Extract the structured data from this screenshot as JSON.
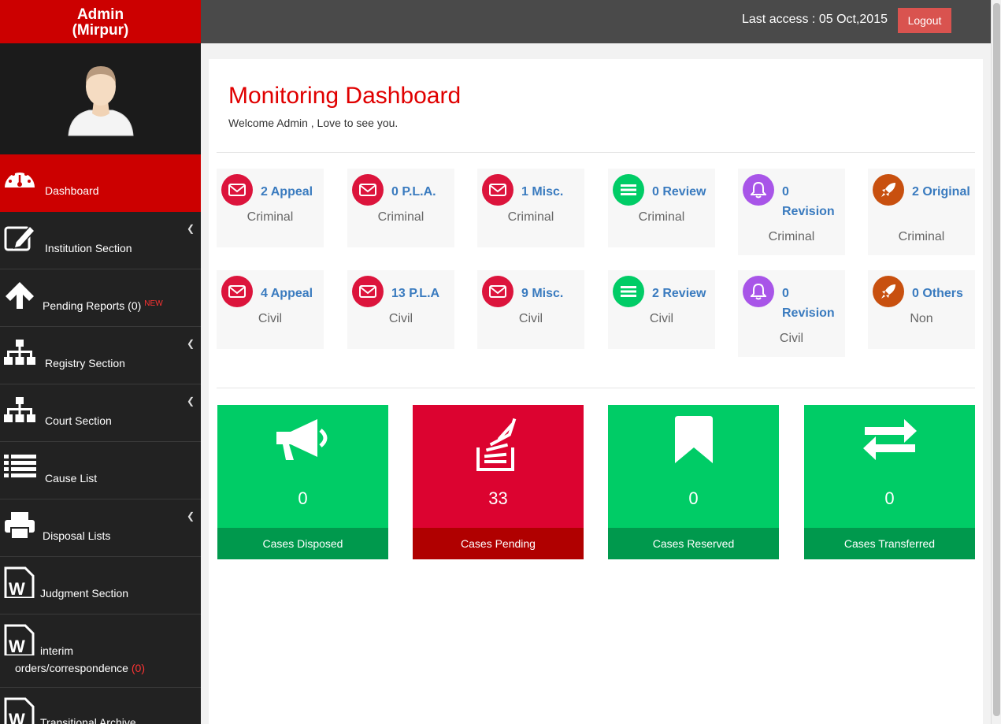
{
  "brand": {
    "line1": "Admin",
    "line2": "(Mirpur)"
  },
  "topbar": {
    "last_access": "Last access : 05 Oct,2015",
    "logout_label": "Logout"
  },
  "sidebar": {
    "items": [
      {
        "label": "Dashboard",
        "icon": "dashboard-icon"
      },
      {
        "label": "Institution Section",
        "icon": "edit-icon"
      },
      {
        "label": "Pending Reports (0)",
        "badge": "NEW",
        "icon": "arrow-up-icon"
      },
      {
        "label": "Registry Section",
        "icon": "sitemap-icon"
      },
      {
        "label": "Court Section",
        "icon": "sitemap-icon"
      },
      {
        "label": "Cause List",
        "icon": "list-icon"
      },
      {
        "label": "Disposal Lists",
        "icon": "print-icon"
      },
      {
        "label": "Judgment Section",
        "icon": "word-file-icon"
      },
      {
        "label_line1": "interim",
        "label_line2": "orders/correspondence",
        "count": "(0)",
        "icon": "word-file-icon"
      },
      {
        "label": "Transitional Archive",
        "icon": "word-file-icon"
      }
    ]
  },
  "main": {
    "title": "Monitoring Dashboard",
    "welcome": "Welcome Admin , Love to see you."
  },
  "stats": [
    {
      "value": "2 Appeal",
      "sub": "Criminal",
      "icon": "envelope-icon"
    },
    {
      "value": "0 P.L.A.",
      "sub": "Criminal",
      "icon": "envelope-icon"
    },
    {
      "value": "1 Misc.",
      "sub": "Criminal",
      "icon": "envelope-icon"
    },
    {
      "value": "0 Review",
      "sub": "Criminal",
      "icon": "bars-icon"
    },
    {
      "value": "0 Revision",
      "sub": "Criminal",
      "icon": "bell-icon"
    },
    {
      "value": "2 Original",
      "sub": "Criminal",
      "icon": "rocket-icon"
    },
    {
      "value": "4 Appeal",
      "sub": "Civil",
      "icon": "envelope-icon"
    },
    {
      "value": "13 P.L.A",
      "sub": "Civil",
      "icon": "envelope-icon"
    },
    {
      "value": "9 Misc.",
      "sub": "Civil",
      "icon": "envelope-icon"
    },
    {
      "value": "2 Review",
      "sub": "Civil",
      "icon": "bars-icon"
    },
    {
      "value": "0 Revision",
      "sub": "Civil",
      "icon": "bell-icon"
    },
    {
      "value": "0 Others",
      "sub": "Non",
      "icon": "rocket-icon"
    }
  ],
  "summary": [
    {
      "count": "0",
      "label": "Cases Disposed",
      "icon": "bullhorn-icon"
    },
    {
      "count": "33",
      "label": "Cases Pending",
      "icon": "stack-icon"
    },
    {
      "count": "0",
      "label": "Cases Reserved",
      "icon": "bookmark-icon"
    },
    {
      "count": "0",
      "label": "Cases Transferred",
      "icon": "exchange-icon"
    }
  ],
  "colors": {
    "brand_red": "#cc0000",
    "envelope_red": "#dc143c",
    "green": "#00cc66",
    "green_dark": "#00994d",
    "purple": "#a855e8",
    "orange": "#c8500f",
    "pending_red": "#dc0330",
    "pending_dark": "#b00000",
    "link_blue": "#3a7bbf"
  }
}
